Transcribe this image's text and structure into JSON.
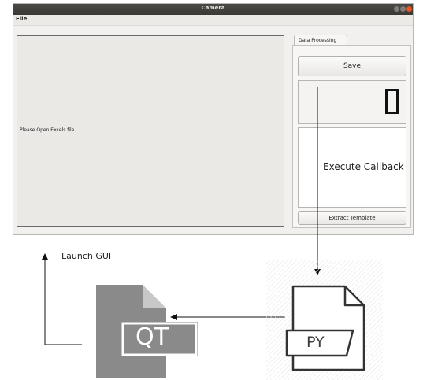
{
  "window": {
    "title": "Camera"
  },
  "menu": {
    "file_label": "File"
  },
  "display": {
    "message": "Please Open Excels file"
  },
  "tabs": [
    {
      "label": "Data Processing"
    }
  ],
  "panel": {
    "save_label": "Save",
    "lcd_value": "0",
    "extract_label": "Extract Template"
  },
  "diagram": {
    "execute_label": "Execute Callback",
    "launch_label": "Launch GUI",
    "qt_icon_label": "QT",
    "py_icon_label": "PY"
  },
  "colors": {
    "title_bar": "#3a3935",
    "close_button": "#e95420",
    "qt_icon": "#8a8a8a"
  }
}
